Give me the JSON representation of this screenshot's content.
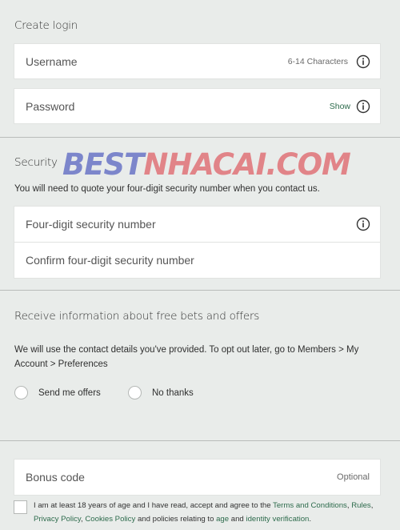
{
  "create_login": {
    "title": "Create login",
    "username": {
      "label": "Username",
      "hint": "6-14 Characters"
    },
    "password": {
      "label": "Password",
      "hint": "Show"
    }
  },
  "security": {
    "title": "Security",
    "note": "You will need to quote your four-digit security number when you contact us.",
    "pin": {
      "label": "Four-digit security number"
    },
    "confirm_pin": {
      "label": "Confirm four-digit security number"
    }
  },
  "watermark": {
    "part1": "BEST",
    "part2": "NHACAI.COM"
  },
  "offers": {
    "title": "Receive information about free bets and offers",
    "note": "We will use the contact details you've provided. To opt out later, go to Members > My Account > Preferences",
    "options": [
      {
        "label": "Send me offers",
        "selected": false
      },
      {
        "label": "No thanks",
        "selected": false
      }
    ]
  },
  "bonus": {
    "label": "Bonus code",
    "hint": "Optional"
  },
  "terms": {
    "prefix": "I am at least 18 years of age and I have read, accept and agree to the",
    "link_terms": "Terms and Conditions",
    "link_rules": "Rules",
    "link_privacy": "Privacy Policy",
    "link_cookies": "Cookies Policy",
    "middle": "and policies relating to",
    "link_age": "age",
    "and": "and",
    "link_identity": "identity verification"
  },
  "colors": {
    "background": "#e9ecea",
    "link": "#2d6b4c",
    "watermark_blue": "#6a75c6",
    "watermark_red": "#e07277"
  },
  "icons": {
    "info": "info-circle-icon"
  }
}
